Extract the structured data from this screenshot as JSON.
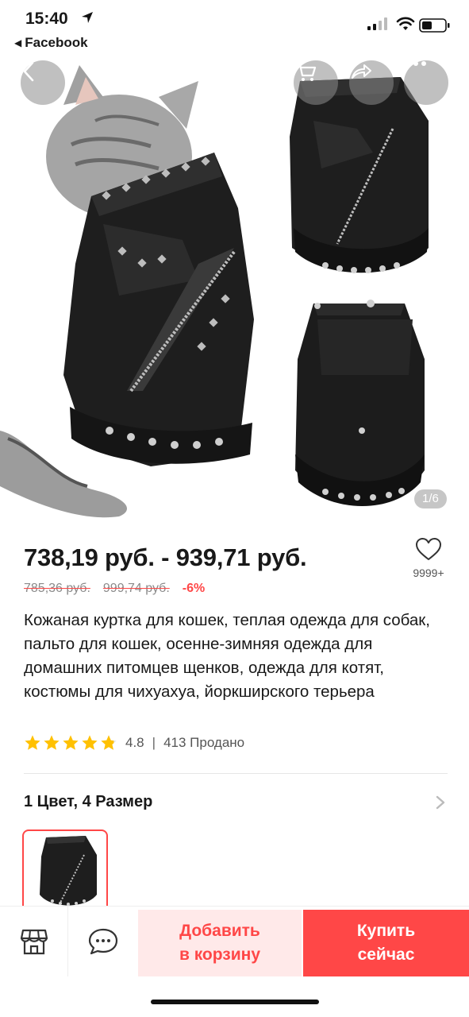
{
  "status": {
    "time": "15:40",
    "back_app": "Facebook"
  },
  "gallery": {
    "counter": "1/6"
  },
  "product": {
    "price_range": "738,19 руб. - 939,71 руб.",
    "old_price_low": "785,36 руб.",
    "old_price_high": "999,74 руб.",
    "discount": "-6%",
    "wishlist_count": "9999+",
    "title": "Кожаная куртка для кошек, теплая одежда для собак, пальто для кошек, осенне-зимняя одежда для домашних питомцев щенков, одежда для котят, костюмы для чихуахуа, йоркширского терьера",
    "rating": "4.8",
    "rating_stars": 4.8,
    "sold": "413 Продано",
    "variants": "1 Цвет, 4 Размер"
  },
  "actions": {
    "add_to_cart_line1": "Добавить",
    "add_to_cart_line2": "в корзину",
    "buy_now_line1": "Купить",
    "buy_now_line2": "сейчас"
  },
  "colors": {
    "accent": "#ff4747",
    "star": "#ffc100"
  }
}
